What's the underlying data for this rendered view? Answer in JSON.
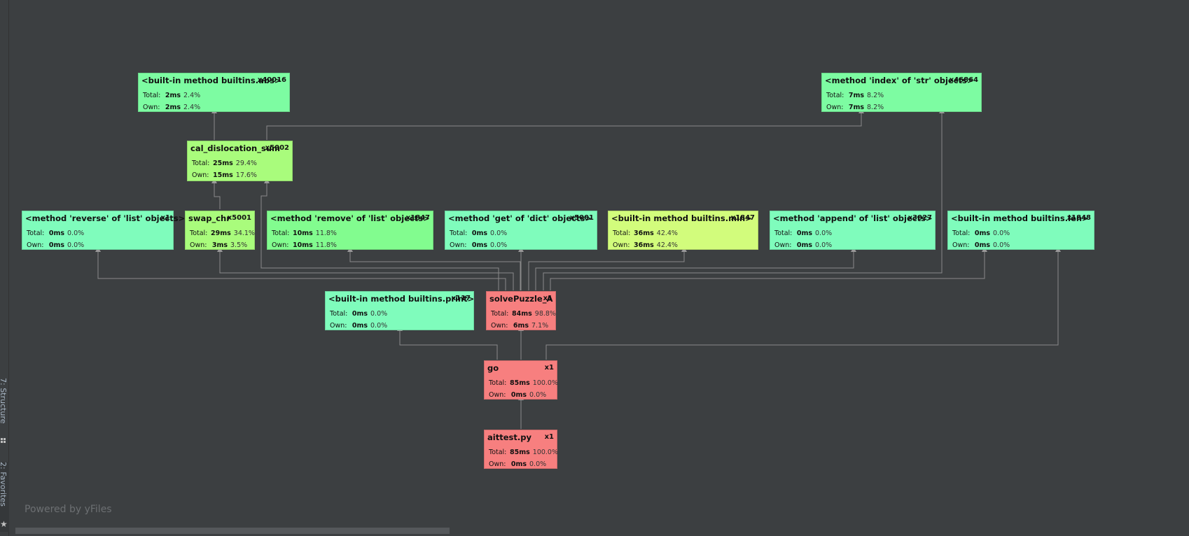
{
  "sidebar": {
    "structure_label": "7: Structure",
    "favorites_label": "2: Favorites"
  },
  "footer": {
    "powered_by": "Powered by yFiles"
  },
  "labels": {
    "total": "Total:",
    "own": "Own:"
  },
  "nodes": [
    {
      "id": "abs",
      "name": "<built-in method builtins.abs>",
      "count": "x40016",
      "total_ms": "2ms",
      "total_pct": "2.4%",
      "own_ms": "2ms",
      "own_pct": "2.4%",
      "color": "#7dfca2"
    },
    {
      "id": "index",
      "name": "<method 'index' of 'str' objects>",
      "count": "x46864",
      "total_ms": "7ms",
      "total_pct": "8.2%",
      "own_ms": "7ms",
      "own_pct": "8.2%",
      "color": "#7dfca2"
    },
    {
      "id": "cal",
      "name": "cal_dislocation_sum",
      "count": "x5002",
      "total_ms": "25ms",
      "total_pct": "29.4%",
      "own_ms": "15ms",
      "own_pct": "17.6%",
      "color": "#a9fc7c"
    },
    {
      "id": "reverse",
      "name": "<method 'reverse' of 'list' objects>",
      "count": "x1",
      "total_ms": "0ms",
      "total_pct": "0.0%",
      "own_ms": "0ms",
      "own_pct": "0.0%",
      "color": "#7ffcbc"
    },
    {
      "id": "swap",
      "name": "swap_chr",
      "count": "x5001",
      "total_ms": "29ms",
      "total_pct": "34.1%",
      "own_ms": "3ms",
      "own_pct": "3.5%",
      "color": "#a9fc7c"
    },
    {
      "id": "remove",
      "name": "<method 'remove' of 'list' objects>",
      "count": "x1847",
      "total_ms": "10ms",
      "total_pct": "11.8%",
      "own_ms": "10ms",
      "own_pct": "11.8%",
      "color": "#82fc8f"
    },
    {
      "id": "get",
      "name": "<method 'get' of 'dict' objects>",
      "count": "x5001",
      "total_ms": "0ms",
      "total_pct": "0.0%",
      "own_ms": "0ms",
      "own_pct": "0.0%",
      "color": "#7ffcbc"
    },
    {
      "id": "min",
      "name": "<built-in method builtins.min>",
      "count": "x1847",
      "total_ms": "36ms",
      "total_pct": "42.4%",
      "own_ms": "36ms",
      "own_pct": "42.4%",
      "color": "#d2fc7c"
    },
    {
      "id": "append",
      "name": "<method 'append' of 'list' objects>",
      "count": "x3027",
      "total_ms": "0ms",
      "total_pct": "0.0%",
      "own_ms": "0ms",
      "own_pct": "0.0%",
      "color": "#7ffcbc"
    },
    {
      "id": "len",
      "name": "<built-in method builtins.len>",
      "count": "x1848",
      "total_ms": "0ms",
      "total_pct": "0.0%",
      "own_ms": "0ms",
      "own_pct": "0.0%",
      "color": "#7ffcbc"
    },
    {
      "id": "print",
      "name": "<built-in method builtins.print>",
      "count": "x117",
      "total_ms": "0ms",
      "total_pct": "0.0%",
      "own_ms": "0ms",
      "own_pct": "0.0%",
      "color": "#7ffcbc"
    },
    {
      "id": "solve",
      "name": "solvePuzzle_A",
      "count": "x1",
      "total_ms": "84ms",
      "total_pct": "98.8%",
      "own_ms": "6ms",
      "own_pct": "7.1%",
      "color": "#f77f7f"
    },
    {
      "id": "go",
      "name": "go",
      "count": "x1",
      "total_ms": "85ms",
      "total_pct": "100.0%",
      "own_ms": "0ms",
      "own_pct": "0.0%",
      "color": "#f77f7f"
    },
    {
      "id": "aittest",
      "name": "aittest.py",
      "count": "x1",
      "total_ms": "85ms",
      "total_pct": "100.0%",
      "own_ms": "0ms",
      "own_pct": "0.0%",
      "color": "#f77f7f"
    }
  ]
}
